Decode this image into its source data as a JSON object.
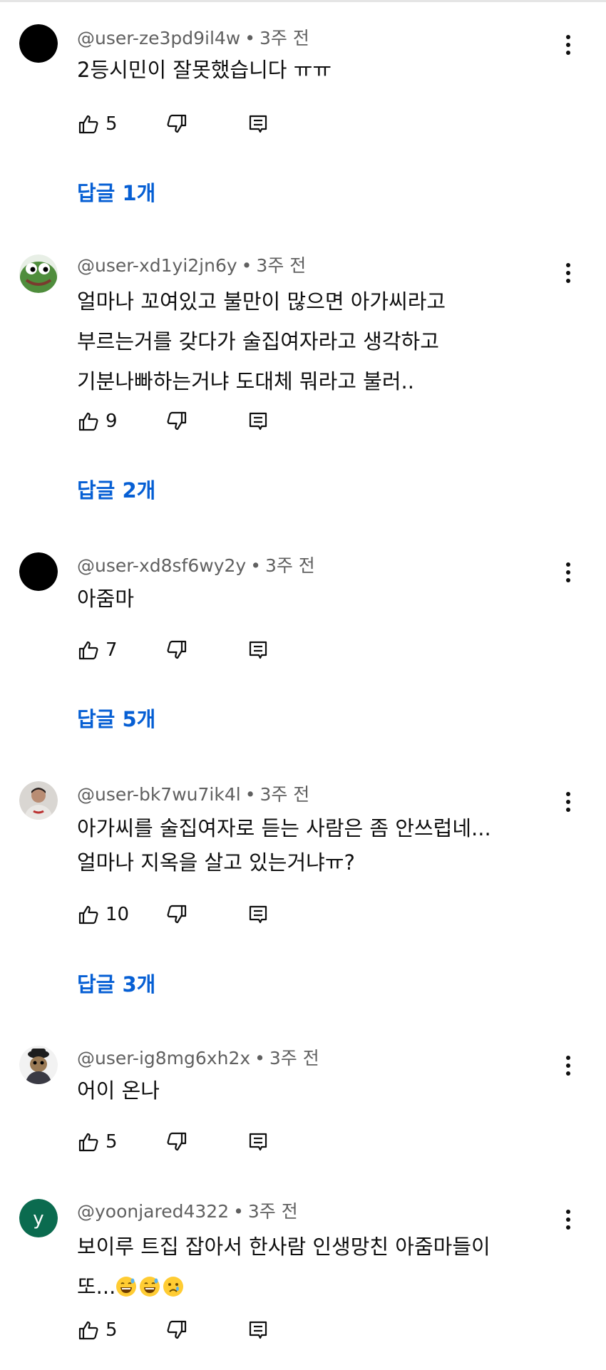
{
  "comments": [
    {
      "author": "@user-ze3pd9il4w",
      "time": "3주 전",
      "lines": [
        "2등시민이 잘못했습니다 ㅠㅠ"
      ],
      "likes": "5",
      "replies": "답글 1개",
      "avatar": "black-circle-avatar"
    },
    {
      "author": "@user-xd1yi2jn6y",
      "time": "3주 전",
      "lines": [
        "얼마나 꼬여있고 불만이 많으면 아가씨라고",
        "부르는거를 갖다가 술집여자라고 생각하고",
        "기분나빠하는거냐 도대체 뭐라고 불러.."
      ],
      "likes": "9",
      "replies": "답글 2개",
      "avatar": "frog-avatar"
    },
    {
      "author": "@user-xd8sf6wy2y",
      "time": "3주 전",
      "lines": [
        "아줌마"
      ],
      "likes": "7",
      "replies": "답글 5개",
      "avatar": "black-circle-avatar"
    },
    {
      "author": "@user-bk7wu7ik4l",
      "time": "3주 전",
      "lines": [
        "아가씨를 술집여자로 듣는 사람은 좀 안쓰럽네...",
        "얼마나 지옥을 살고 있는거냐ㅠ?"
      ],
      "likes": "10",
      "replies": "답글 3개",
      "avatar": "person-photo-avatar"
    },
    {
      "author": "@user-ig8mg6xh2x",
      "time": "3주 전",
      "lines": [
        "어이 온나"
      ],
      "likes": "5",
      "replies": "",
      "avatar": "character-avatar"
    },
    {
      "author": "@yoonjared4322",
      "time": "3주 전",
      "lines": [
        "보이루 트집 잡아서 한사람 인생망친 아줌마들이",
        "또..."
      ],
      "likes": "5",
      "replies": "",
      "avatar": "letter-avatar",
      "avatar_letter": "y",
      "avatar_color": "#0b6b4f",
      "emojis": [
        "grinning-sweat-emoji",
        "grinning-sweat-emoji",
        "crying-face-emoji"
      ]
    }
  ],
  "colors": {
    "reply_link": "#065fd4",
    "meta_text": "#606060",
    "body_text": "#0f0f0f"
  }
}
